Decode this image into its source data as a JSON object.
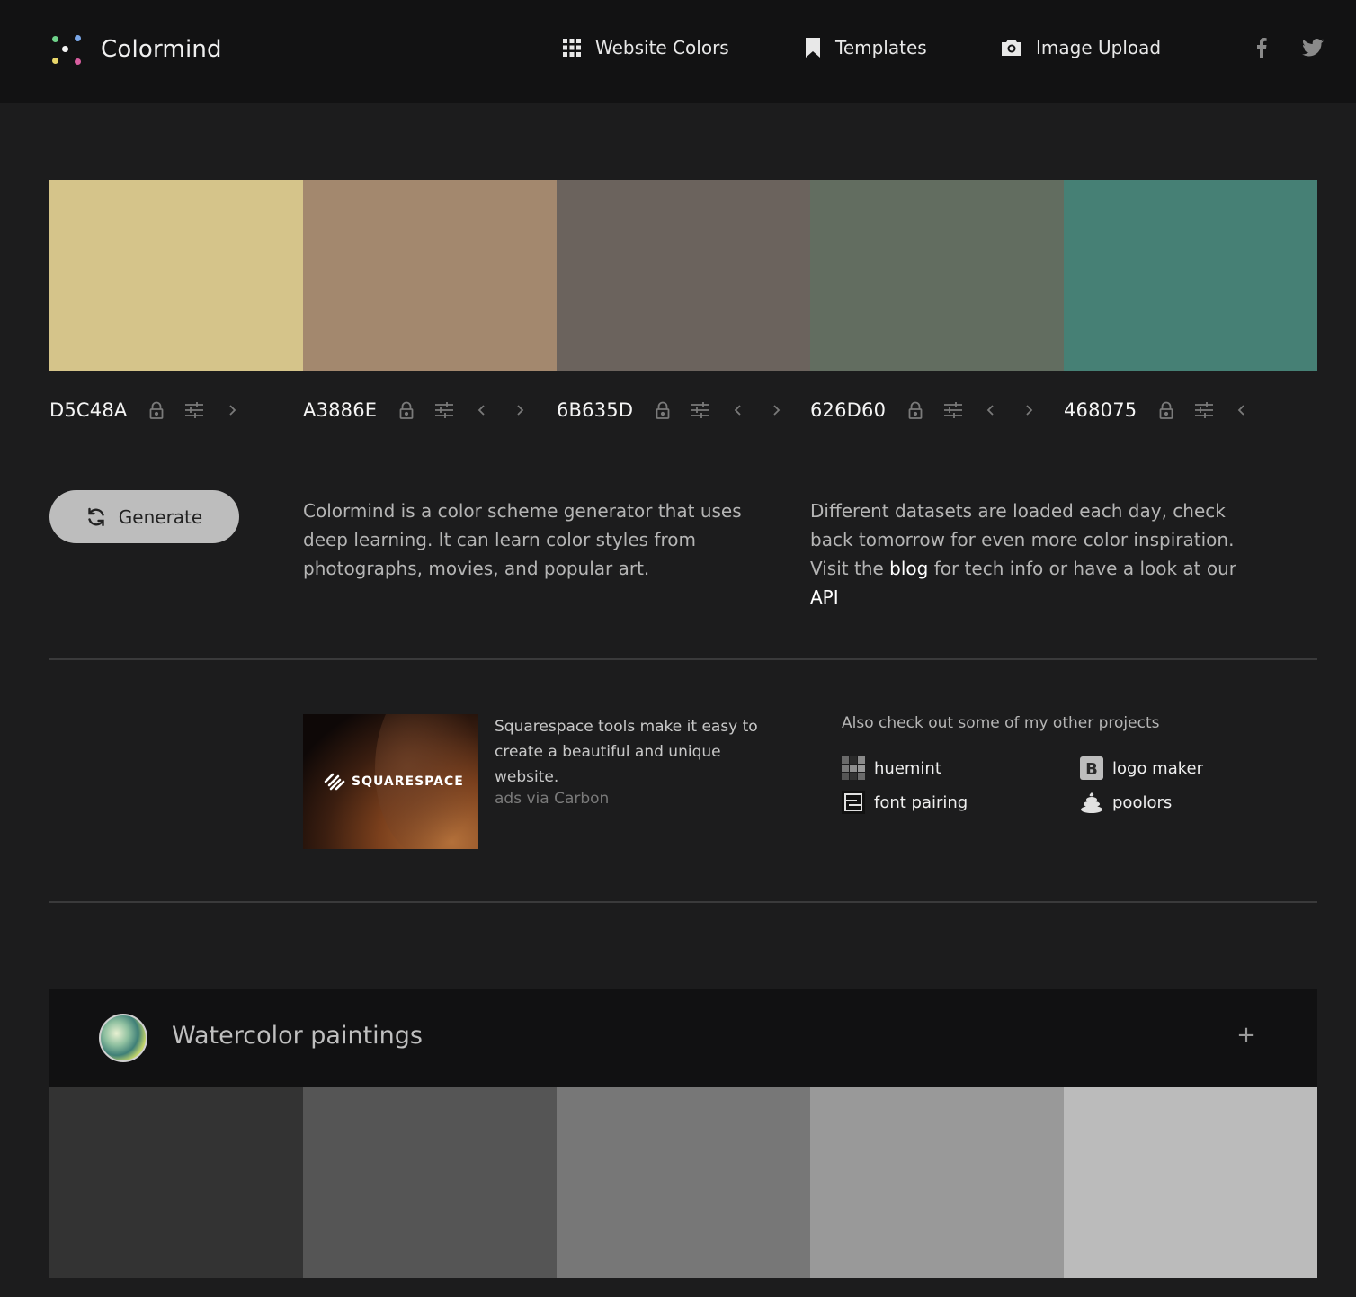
{
  "header": {
    "brand": "Colormind",
    "nav": [
      {
        "label": "Website Colors",
        "icon": "grid-icon"
      },
      {
        "label": "Templates",
        "icon": "bookmark-icon"
      },
      {
        "label": "Image Upload",
        "icon": "camera-icon"
      }
    ],
    "social": [
      "facebook-icon",
      "twitter-icon"
    ]
  },
  "palette": [
    {
      "hex": "D5C48A",
      "color": "#D5C48A"
    },
    {
      "hex": "A3886E",
      "color": "#A3886E"
    },
    {
      "hex": "6B635D",
      "color": "#6B635D"
    },
    {
      "hex": "626D60",
      "color": "#626D60"
    },
    {
      "hex": "468075",
      "color": "#468075"
    }
  ],
  "generate_label": "Generate",
  "description_left": "Colormind is a color scheme generator that uses deep learning. It can learn color styles from photographs, movies, and popular art.",
  "description_right": {
    "part1": "Different datasets are loaded each day, check back tomorrow for even more color inspiration. Visit the ",
    "blog_link": "blog",
    "part2": " for tech info or have a look at our ",
    "api_link": "API"
  },
  "ad": {
    "logo_text": "SQUARESPACE",
    "text": "Squarespace tools make it easy to create a beautiful and unique website.",
    "via": "ads via Carbon"
  },
  "other_projects": {
    "title": "Also check out some of my other projects",
    "items": [
      {
        "label": "huemint",
        "icon": "huemint-icon"
      },
      {
        "label": "logo maker",
        "icon": "logo-maker-icon"
      },
      {
        "label": "font pairing",
        "icon": "font-pairing-icon"
      },
      {
        "label": "poolors",
        "icon": "poolors-icon"
      }
    ]
  },
  "category": {
    "title": "Watercolor paintings",
    "plus": "+",
    "swatches": [
      "#333333",
      "#555555",
      "#777777",
      "#999999",
      "#BBBBBB"
    ]
  },
  "colors": {
    "header_bg": "#121213",
    "page_bg": "#1c1c1d",
    "button_bg": "#bdbdbd"
  }
}
